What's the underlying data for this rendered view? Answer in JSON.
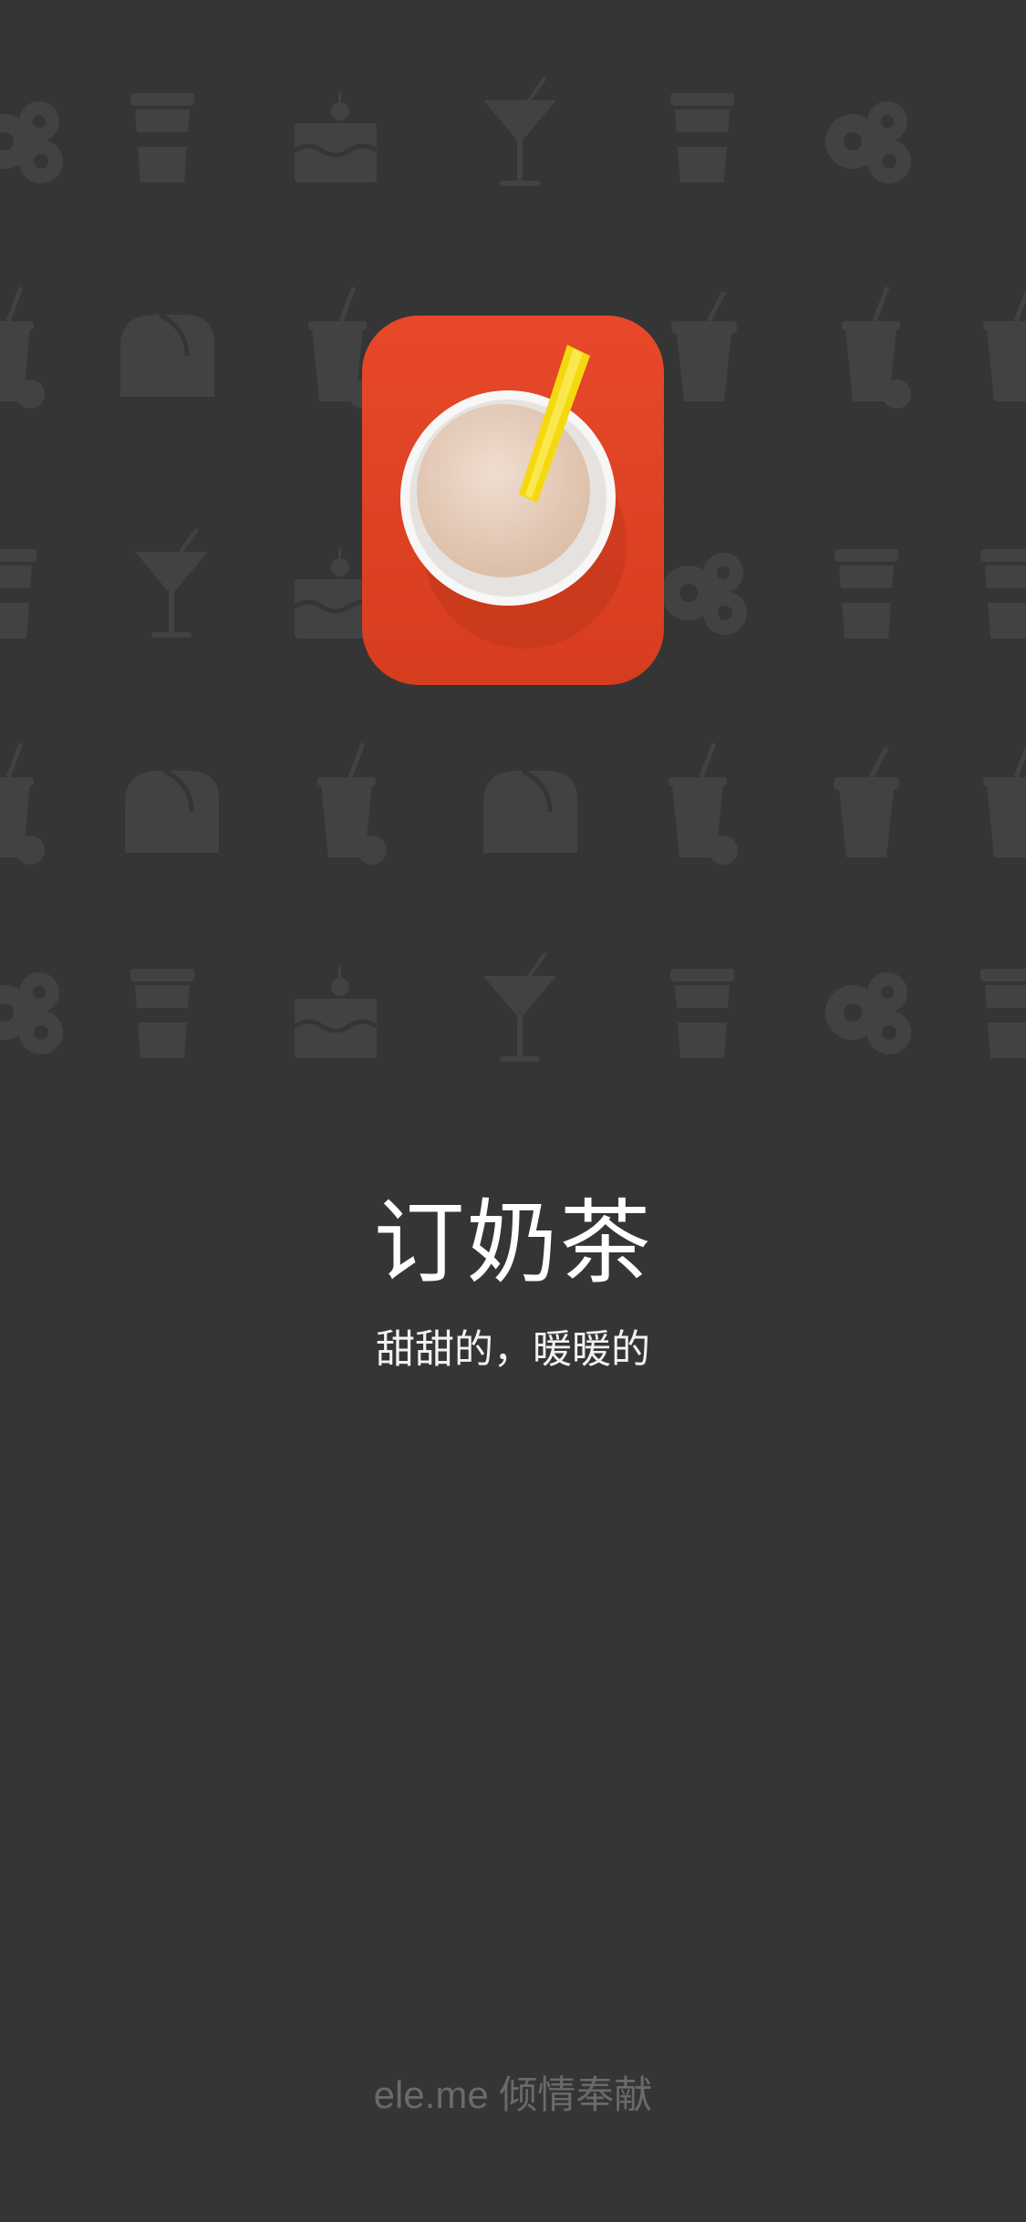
{
  "splash": {
    "title": "订奶茶",
    "tagline": "甜甜的，暖暖的",
    "credit": "ele.me  倾情奉献"
  },
  "icons": {
    "app_icon": "milk-tea-cup-icon",
    "background_pattern": [
      "donut-icon",
      "coffee-cup-icon",
      "cake-icon",
      "cocktail-icon",
      "bread-icon",
      "milkshake-icon",
      "drink-cup-icon"
    ]
  },
  "colors": {
    "background": "#353535",
    "pattern": "#424242",
    "icon_red": "#e04020",
    "straw_yellow": "#f5d90f",
    "title_text": "#ffffff",
    "credit_text": "#6a6a6a"
  }
}
